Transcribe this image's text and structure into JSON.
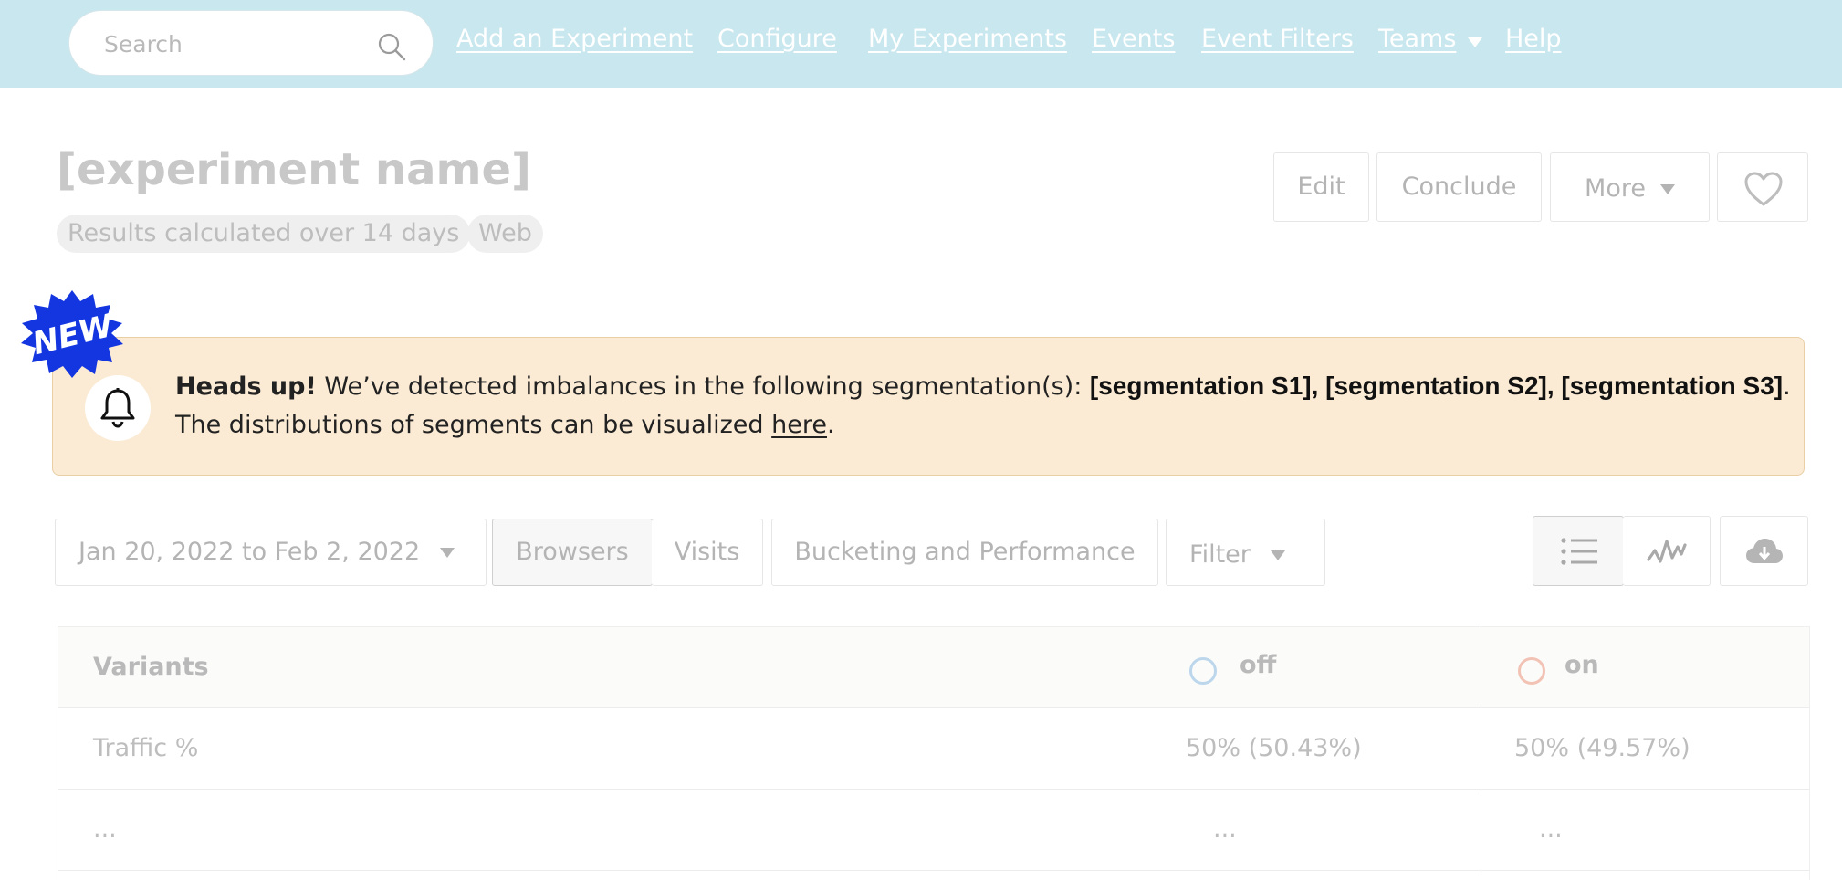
{
  "nav": {
    "search_placeholder": "Search",
    "links": [
      "Add an Experiment",
      "Configure",
      "My Experiments",
      "Events",
      "Event Filters",
      "Teams",
      "Help"
    ]
  },
  "header": {
    "title": "[experiment name]",
    "tags": [
      "Results calculated over 14 days",
      "Web"
    ],
    "buttons": {
      "edit": "Edit",
      "conclude": "Conclude",
      "more": "More"
    }
  },
  "badge": {
    "text": "NEW"
  },
  "alert": {
    "heads_up": "Heads up!",
    "message": " We’ve detected imbalances in the following segmentation(s): ",
    "segments": "[segmentation S1], [segmentation S2], [segmentation S3]",
    "end": ".",
    "line2_text": "The distributions of segments can be visualized ",
    "link_text": "here",
    "line2_end": "."
  },
  "toolbar": {
    "date_range": "Jan 20, 2022 to Feb 2, 2022",
    "tabs": [
      "Browsers",
      "Visits"
    ],
    "bucketing": "Bucketing and Performance",
    "filter": "Filter"
  },
  "table": {
    "header": {
      "label": "Variants",
      "variants": [
        "off",
        "on"
      ]
    },
    "variant_colors": [
      "#bcd6ec",
      "#f2c3b5"
    ],
    "rows": [
      {
        "label": "Traffic %",
        "values": [
          "50% (50.43%)",
          "50% (49.57%)"
        ]
      },
      {
        "label": "...",
        "values": [
          "...",
          "..."
        ]
      }
    ]
  },
  "colors": {
    "nav_bg": "#c8e7ee",
    "alert_bg": "#fbebd4",
    "badge_blue": "#1436e0"
  }
}
